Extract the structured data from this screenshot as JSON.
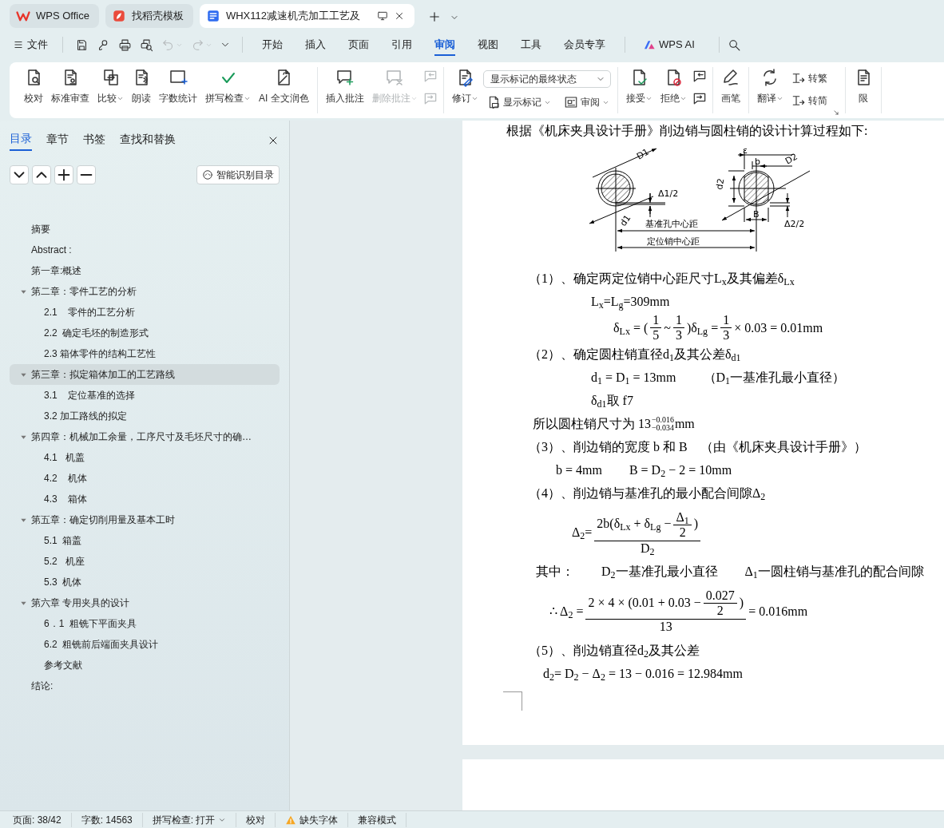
{
  "tabs": [
    {
      "kind": "wps",
      "label": "WPS Office",
      "selected": false
    },
    {
      "kind": "docer",
      "label": "找稻壳模板",
      "selected": false
    },
    {
      "kind": "doc",
      "label": "WHX112减速机壳加工工艺及",
      "selected": true
    }
  ],
  "menu": {
    "file": "文件",
    "quick_access": [
      {
        "disabled": false
      },
      {
        "disabled": false
      },
      {
        "disabled": false
      },
      {
        "disabled": false
      },
      {
        "disabled": true
      },
      {
        "disabled": true
      }
    ],
    "items": [
      {
        "label": "开始",
        "selected": false
      },
      {
        "label": "插入",
        "selected": false
      },
      {
        "label": "页面",
        "selected": false
      },
      {
        "label": "引用",
        "selected": false
      },
      {
        "label": "审阅",
        "selected": true
      },
      {
        "label": "视图",
        "selected": false
      },
      {
        "label": "工具",
        "selected": false
      },
      {
        "label": "会员专享",
        "selected": false
      }
    ],
    "ai": "WPS AI"
  },
  "ribbon": {
    "groups": [
      {
        "items": [
          {
            "kind": "big",
            "label": "校对",
            "caret": false,
            "disabled": false
          },
          {
            "kind": "big",
            "label": "标准审查",
            "caret": false,
            "disabled": false
          },
          {
            "kind": "big",
            "label": "比较",
            "caret": true,
            "disabled": false
          },
          {
            "kind": "big",
            "label": "朗读",
            "caret": false,
            "disabled": false
          },
          {
            "kind": "big",
            "label": "字数统计",
            "caret": false,
            "disabled": false
          },
          {
            "kind": "big",
            "label": "拼写检查",
            "caret": true,
            "disabled": false
          },
          {
            "kind": "big",
            "label": "AI 全文润色",
            "caret": false,
            "disabled": false
          }
        ]
      },
      {
        "items": [
          {
            "kind": "big",
            "label": "插入批注",
            "caret": false,
            "disabled": false
          },
          {
            "kind": "big",
            "label": "删除批注",
            "caret": true,
            "disabled": true
          },
          {
            "kind": "icon-pair",
            "disabled": true
          }
        ]
      },
      {
        "items": [
          {
            "kind": "big",
            "label": "修订",
            "caret": true,
            "disabled": false
          },
          {
            "kind": "stack",
            "select": "显示标记的最终状态",
            "buttons": [
              {
                "label": "显示标记",
                "caret": true
              },
              {
                "label": "审阅",
                "caret": true
              }
            ]
          }
        ]
      },
      {
        "items": [
          {
            "kind": "big",
            "label": "接受",
            "caret": true,
            "disabled": false
          },
          {
            "kind": "big",
            "label": "拒绝",
            "caret": true,
            "disabled": false
          },
          {
            "kind": "icon-pair",
            "disabled": false
          }
        ]
      },
      {
        "items": [
          {
            "kind": "big",
            "label": "画笔",
            "caret": false,
            "disabled": false
          }
        ]
      },
      {
        "items": [
          {
            "kind": "big",
            "label": "翻译",
            "caret": true,
            "disabled": false
          },
          {
            "kind": "pair-labels",
            "buttons": [
              {
                "label": "转繁",
                "caret": false
              },
              {
                "label": "转简",
                "caret": false
              }
            ]
          }
        ]
      },
      {
        "items": [
          {
            "kind": "big",
            "label": "限",
            "caret": false,
            "disabled": false
          }
        ]
      }
    ]
  },
  "sidebar": {
    "tabs": [
      {
        "label": "目录",
        "selected": true
      },
      {
        "label": "章节",
        "selected": false
      },
      {
        "label": "书签",
        "selected": false
      },
      {
        "label": "查找和替换",
        "selected": false
      }
    ],
    "smart_button": "智能识别目录",
    "toc": [
      {
        "label": "摘要",
        "selected": false
      },
      {
        "label": "Abstract :",
        "selected": false
      },
      {
        "label": "第一章:概述",
        "selected": false
      },
      {
        "label": "第二章：零件工艺的分析",
        "selected": false,
        "expanded": true,
        "children": [
          {
            "label": "2.1    零件的工艺分析",
            "selected": false
          },
          {
            "label": "2.2  确定毛坯的制造形式",
            "selected": false
          },
          {
            "label": "2.3 箱体零件的结构工艺性",
            "selected": false
          }
        ]
      },
      {
        "label": "第三章：拟定箱体加工的工艺路线",
        "selected": true,
        "expanded": true,
        "children": [
          {
            "label": "3.1    定位基准的选择",
            "selected": false
          },
          {
            "label": "3.2 加工路线的拟定",
            "selected": false
          }
        ]
      },
      {
        "label": "第四章：机械加工余量，工序尺寸及毛坯尺寸的确…",
        "selected": false,
        "expanded": true,
        "children": [
          {
            "label": "4.1   机盖",
            "selected": false
          },
          {
            "label": "4.2    机体",
            "selected": false
          },
          {
            "label": "4.3    箱体",
            "selected": false
          }
        ]
      },
      {
        "label": "第五章：确定切削用量及基本工时",
        "selected": false,
        "expanded": true,
        "children": [
          {
            "label": "5.1  箱盖",
            "selected": false
          },
          {
            "label": "5.2   机座",
            "selected": false
          },
          {
            "label": "5.3  机体",
            "selected": false
          }
        ]
      },
      {
        "label": "第六章 专用夹具的设计",
        "selected": false,
        "expanded": true,
        "children": [
          {
            "label": "6．1  粗铣下平面夹具",
            "selected": false
          },
          {
            "label": "6.2  粗铣前后端面夹具设计",
            "selected": false
          },
          {
            "label": "参考文献",
            "selected": false
          }
        ]
      },
      {
        "label": "结论:",
        "selected": false
      }
    ]
  },
  "document": {
    "intro": "根据《机床夹具设计手册》削边销与圆柱销的设计计算过程如下:",
    "diagram": {
      "labels": [
        "D1",
        "d1",
        "Δ1/2",
        "ε",
        "b",
        "D2",
        "d2",
        "B",
        "Δ2/2",
        "基准孔中心距",
        "定位销中心距"
      ]
    },
    "lines": [
      {
        "kind": "step",
        "segments": [
          [
            "（1）、确定两定位销中心距尺寸L$_{x}$及其偏差δ$_{Lx}$"
          ]
        ]
      },
      {
        "kind": "eq",
        "segments": [
          [
            "L$_{x}$=L$_{g}$=309mm"
          ]
        ]
      },
      {
        "kind": "eq-wide",
        "segments": [
          [
            "δ$_{Lx}$ = (",
            {
              "num": [
                "1"
              ],
              "den": [
                "5"
              ]
            },
            "~",
            {
              "num": [
                "1"
              ],
              "den": [
                "3"
              ]
            },
            ")δ$_{Lg}$ =",
            {
              "num": [
                "1"
              ],
              "den": [
                "3"
              ]
            },
            "× 0.03 = 0.01mm"
          ]
        ]
      },
      {
        "kind": "step",
        "segments": [
          [
            "（2）、确定圆柱销直径d$_{1}$及其公差δ$_{d1}$"
          ]
        ]
      },
      {
        "kind": "eq",
        "segments": [
          [
            "d$_{1}$ = D$_{1}$ = 13mm"
          ],
          [
            "（D$_{1}$一基准孔最小直径）"
          ]
        ]
      },
      {
        "kind": "eq",
        "segments": [
          [
            "δ$_{d1}$取 f7"
          ]
        ]
      },
      {
        "kind": "note",
        "segments": [
          [
            "所以圆柱销尺寸为 13",
            {
              "sup": "−0.016",
              "sub": "−0.034"
            },
            "mm"
          ]
        ]
      },
      {
        "kind": "step",
        "segments": [
          [
            "（3）、削边销的宽度 b 和 B　（由《机床夹具设计手册》）"
          ]
        ]
      },
      {
        "kind": "eq-short",
        "segments": [
          [
            "b = 4mm"
          ],
          [
            "B = D$_{2}$ − 2 = 10mm"
          ]
        ]
      },
      {
        "kind": "step",
        "segments": [
          [
            "（4）、削边销与基准孔的最小配合间隙Δ$_{2}$"
          ]
        ]
      },
      {
        "kind": "eq-frac",
        "segments": [
          [
            "Δ$_{2}$=",
            {
              "num": [
                "2b(δ$_{Lx}$ + δ$_{Lg}$ −",
                {
                  "num": [
                    "Δ$_{1}$"
                  ],
                  "den": [
                    "2"
                  ]
                },
                ")"
              ],
              "den": [
                "D$_{2}$"
              ]
            }
          ]
        ]
      },
      {
        "kind": "note-wide",
        "segments": [
          [
            "其中："
          ],
          [
            "D$_{2}$一基准孔最小直径"
          ],
          [
            "Δ$_{1}$一圆柱销与基准孔的配合间隙"
          ]
        ]
      },
      {
        "kind": "eq-therefore",
        "segments": [
          [
            "∴ Δ$_{2}$ =",
            {
              "num": [
                "2 × 4 × (0.01 + 0.03 −",
                {
                  "num": [
                    "0.027"
                  ],
                  "den": [
                    "2"
                  ]
                },
                ")"
              ],
              "den": [
                "13"
              ]
            },
            "= 0.016mm"
          ]
        ]
      },
      {
        "kind": "step",
        "segments": [
          [
            "（5）、削边销直径d$_{2}$及其公差"
          ]
        ]
      },
      {
        "kind": "eq-result",
        "segments": [
          [
            "d$_{2}$= D$_{2}$ − Δ$_{2}$ = 13 − 0.016 = 12.984mm"
          ]
        ]
      }
    ]
  },
  "status_bar": [
    {
      "kind": "text",
      "label": "页面: 38/42"
    },
    {
      "kind": "text",
      "label": "字数: 14563"
    },
    {
      "kind": "dropdown",
      "label": "拼写检查: 打开"
    },
    {
      "kind": "button",
      "label": "校对"
    },
    {
      "kind": "warning",
      "label": "缺失字体"
    },
    {
      "kind": "text",
      "label": "兼容模式"
    }
  ]
}
